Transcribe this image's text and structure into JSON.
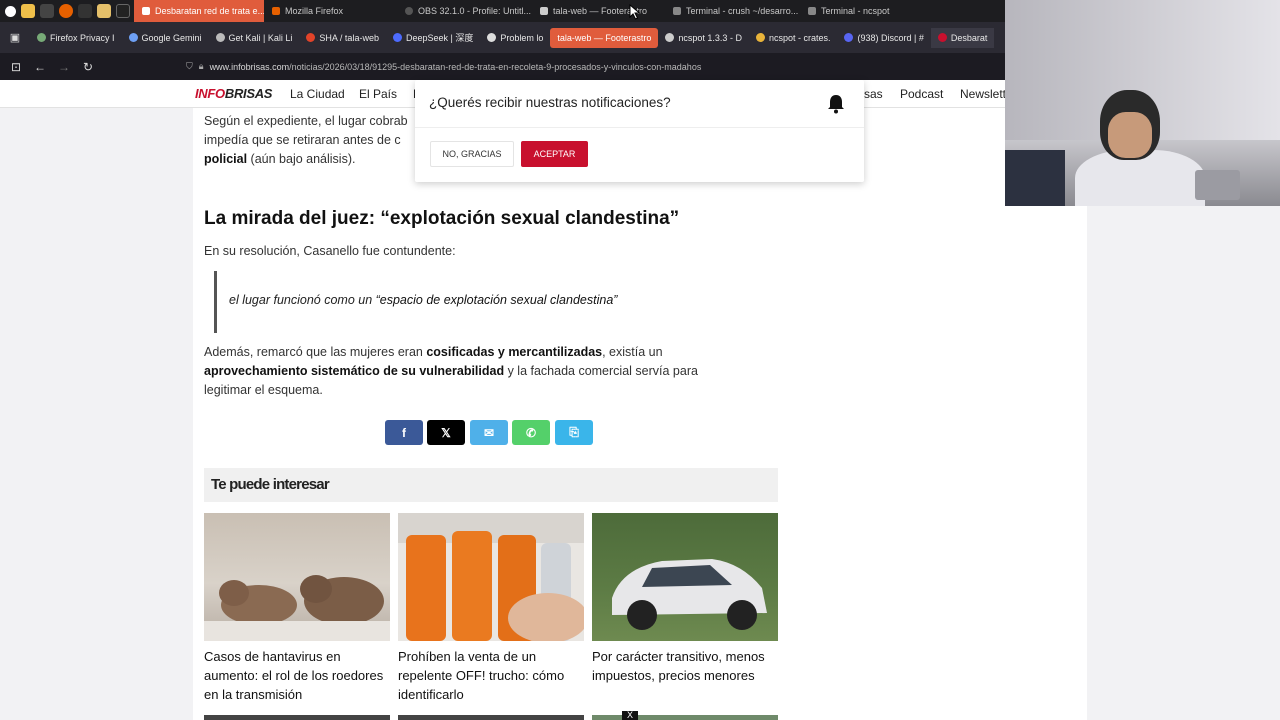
{
  "taskbar": {
    "tabs": [
      {
        "label": "Desbaratan red de trata e...",
        "active": true
      },
      {
        "label": "Mozilla Firefox",
        "active": false
      },
      {
        "label": "OBS 32.1.0 - Profile: Untitl...",
        "active": false
      },
      {
        "label": "tala-web — Footerastro",
        "active": false
      },
      {
        "label": "Terminal - crush ~/desarro...",
        "active": false
      },
      {
        "label": "Terminal - ncspot",
        "active": false
      }
    ]
  },
  "bookmarks": {
    "items": [
      {
        "label": "Firefox Privacy I"
      },
      {
        "label": "Google Gemini"
      },
      {
        "label": "Get Kali | Kali Li"
      },
      {
        "label": "SHA / tala-web"
      },
      {
        "label": "DeepSeek | 深度"
      },
      {
        "label": "Problem lo"
      },
      {
        "label": "tala-web — Footerastro"
      },
      {
        "label": "ncspot 1.3.3 - D"
      },
      {
        "label": "ncspot - crates."
      },
      {
        "label": "(938) Discord | #"
      },
      {
        "label": "Desbarat"
      }
    ]
  },
  "url": {
    "host": "www.infobrisas.com",
    "path": "/noticias/2026/03/18/91295-desbaratan-red-de-trata-en-recoleta-9-procesados-y-vinculos-con-madahos"
  },
  "site": {
    "logo_a": "INFO",
    "logo_b": "BRISAS",
    "nav": [
      "La Ciudad",
      "El País",
      "F",
      "sas",
      "Podcast",
      "Newslett"
    ]
  },
  "article": {
    "p1_a": "Según el expediente, el lugar cobrab",
    "p1_b": "impedía que se retiraran antes de c",
    "p1_bold": "policial",
    "p1_c": " (aún bajo análisis).",
    "heading": "La mirada del juez: “explotación sexual clandestina”",
    "p2": "En su resolución, Casanello fue contundente:",
    "quote_a": "el lugar funcionó como un “",
    "quote_bold": "espacio de explotación sexual clandestina",
    "quote_b": "”",
    "p3_a": "Además, remarcó que las mujeres eran ",
    "p3_bold1": "cosificadas y mercantilizadas",
    "p3_b": ", existía un",
    "p3_bold2": "aprovechamiento sistemático de su vulnerabilidad",
    "p3_c": " y la fachada comercial servía para",
    "p3_d": "legitimar el esquema."
  },
  "share": {
    "facebook": "f",
    "x": "𝕏",
    "email": "✉",
    "whatsapp": "✆",
    "copy": "⎘",
    "colors": {
      "facebook": "#3b5998",
      "x": "#000000",
      "email": "#4fb0e9",
      "whatsapp": "#54d06a",
      "copy": "#3ab5ea"
    }
  },
  "related": {
    "heading": "Te puede interesar",
    "cards": [
      {
        "title": "Casos de hantavirus en aumento: el rol de los roedores en la transmisión"
      },
      {
        "title": "Prohíben la venta de un repelente OFF! trucho: cómo identificarlo"
      },
      {
        "title": "Por carácter transitivo, menos impuestos, precios menores"
      }
    ]
  },
  "popup": {
    "question": "¿Querés recibir nuestras notificaciones?",
    "no": "NO, GRACIAS",
    "yes": "ACEPTAR"
  },
  "close": "X"
}
